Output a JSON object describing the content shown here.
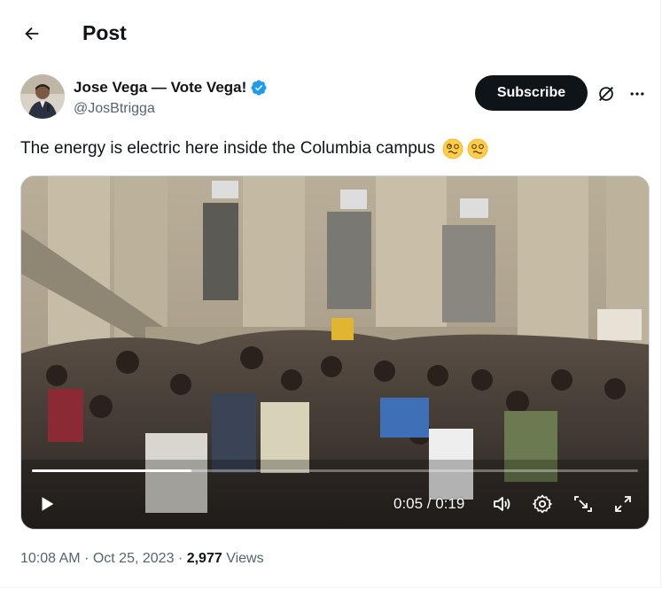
{
  "header": {
    "back_icon": "arrow-left-icon",
    "title": "Post"
  },
  "author": {
    "name": "Jose Vega — Vote Vega!",
    "handle": "@JosBtrigga",
    "verified_color": "#1d9bf0",
    "subscribe_label": "Subscribe"
  },
  "tweet": {
    "text": "The energy is electric here inside the Columbia campus",
    "emojis": [
      "dizzy-face-emoji",
      "dizzy-face-emoji"
    ]
  },
  "video": {
    "current_time": "0:05",
    "duration": "0:19",
    "time_display": "0:05 / 0:19",
    "progress_fraction": 0.263,
    "icons": [
      "play-icon",
      "volume-icon",
      "settings-icon",
      "pip-icon",
      "fullscreen-icon"
    ]
  },
  "meta": {
    "time": "10:08 AM",
    "date": "Oct 25, 2023",
    "views_count": "2,977",
    "views_label": "Views"
  },
  "colors": {
    "text_primary": "#0f1419",
    "text_secondary": "#536471",
    "accent_blue": "#1d9bf0",
    "button_dark": "#0f1419"
  }
}
